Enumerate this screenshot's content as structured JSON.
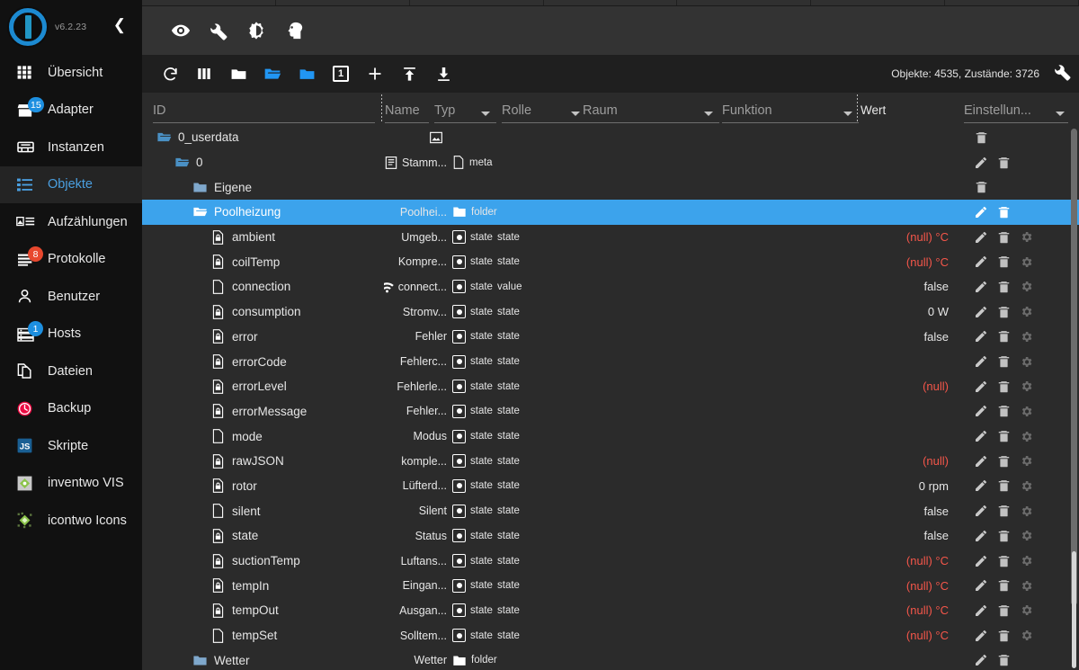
{
  "sidebar": {
    "version": "v6.2.23",
    "collapse_icon": "chevron-left-icon",
    "items": [
      {
        "label": "Übersicht",
        "icon": "grid-icon",
        "badge": null,
        "badge_color": null,
        "active": false
      },
      {
        "label": "Adapter",
        "icon": "shop-icon",
        "badge": "15",
        "badge_color": "#1d8fe0",
        "active": false
      },
      {
        "label": "Instanzen",
        "icon": "instances-icon",
        "badge": null,
        "badge_color": null,
        "active": false
      },
      {
        "label": "Objekte",
        "icon": "list-icon",
        "badge": null,
        "badge_color": null,
        "active": true
      },
      {
        "label": "Aufzählungen",
        "icon": "enums-icon",
        "badge": null,
        "badge_color": null,
        "active": false
      },
      {
        "label": "Protokolle",
        "icon": "logs-icon",
        "badge": "8",
        "badge_color": "#e8482e",
        "active": false
      },
      {
        "label": "Benutzer",
        "icon": "user-icon",
        "badge": null,
        "badge_color": null,
        "active": false
      },
      {
        "label": "Hosts",
        "icon": "hosts-icon",
        "badge": "1",
        "badge_color": "#1d8fe0",
        "active": false
      },
      {
        "label": "Dateien",
        "icon": "files-icon",
        "badge": null,
        "badge_color": null,
        "active": false
      },
      {
        "label": "Backup",
        "icon": "backup-clock-icon",
        "badge": null,
        "badge_color": null,
        "active": false
      },
      {
        "label": "Skripte",
        "icon": "javascript-icon",
        "badge": null,
        "badge_color": null,
        "active": false
      },
      {
        "label": "inventwo VIS",
        "icon": "vis-icon",
        "badge": null,
        "badge_color": null,
        "active": false
      },
      {
        "label": "icontwo Icons",
        "icon": "icons-icon",
        "badge": null,
        "badge_color": null,
        "active": false
      }
    ]
  },
  "app_toolbar": {
    "icons": [
      "eye-icon",
      "wrench-icon",
      "brightness-icon",
      "expert-head-icon"
    ]
  },
  "objects_toolbar": {
    "icons": [
      "refresh-icon",
      "columns-icon",
      "folder-closed-icon",
      "folder-open-icon",
      "folder-filled-icon",
      "depth-1-icon",
      "plus-icon",
      "upload-icon",
      "download-icon"
    ],
    "depth_label": "1",
    "counts": "Objekte: 4535, Zustände: 3726",
    "settings_icon": "wrench-icon"
  },
  "columns": {
    "id": "ID",
    "name": "Name",
    "typ": "Typ",
    "rolle": "Rolle",
    "raum": "Raum",
    "funktion": "Funktion",
    "wert": "Wert",
    "einstellungen": "Einstellun..."
  },
  "colors": {
    "accent": "#3ca3ec",
    "null_value": "#f4564a",
    "sidebar_bg": "#111111",
    "main_bg": "#2b2b2b",
    "toolbar_bg": "#333333",
    "objtoolbar_bg": "#1f1f1f"
  },
  "rows": [
    {
      "id": "0_userdata",
      "indent": 0,
      "kind": "folder-open",
      "name": "",
      "name_icon": "image-icon",
      "typ": "",
      "typ_icon": "",
      "rolle": "",
      "value": "",
      "null": false,
      "actions": [
        "delete"
      ]
    },
    {
      "id": "0",
      "indent": 1,
      "kind": "folder-open",
      "name": "Stamm...",
      "name_icon": "doc-lines-icon",
      "typ": "meta",
      "typ_icon": "file-icon",
      "rolle": "",
      "value": "",
      "null": false,
      "actions": [
        "edit",
        "delete"
      ]
    },
    {
      "id": "Eigene",
      "indent": 2,
      "kind": "folder-filled",
      "name": "",
      "name_icon": "",
      "typ": "",
      "typ_icon": "",
      "rolle": "",
      "value": "",
      "null": false,
      "actions": [
        "delete"
      ]
    },
    {
      "id": "Poolheizung",
      "indent": 2,
      "kind": "folder-open",
      "name": "Poolhei...",
      "name_icon": "",
      "typ": "folder",
      "typ_icon": "folder-filled-icon",
      "rolle": "",
      "value": "",
      "null": false,
      "actions": [
        "edit",
        "delete"
      ],
      "selected": true
    },
    {
      "id": "ambient",
      "indent": 3,
      "kind": "state-lock",
      "name": "Umgeb...",
      "name_icon": "",
      "typ": "state",
      "typ_icon": "state-box-icon",
      "rolle": "state",
      "value": "(null) °C",
      "null": true,
      "actions": [
        "edit",
        "delete",
        "gear"
      ]
    },
    {
      "id": "coilTemp",
      "indent": 3,
      "kind": "state-lock",
      "name": "Kompre...",
      "name_icon": "",
      "typ": "state",
      "typ_icon": "state-box-icon",
      "rolle": "state",
      "value": "(null) °C",
      "null": true,
      "actions": [
        "edit",
        "delete",
        "gear"
      ]
    },
    {
      "id": "connection",
      "indent": 3,
      "kind": "state-plain",
      "name": "connect...",
      "name_icon": "wifi-icon",
      "typ": "state",
      "typ_icon": "state-box-icon",
      "rolle": "value",
      "value": "false",
      "null": false,
      "actions": [
        "edit",
        "delete",
        "gear"
      ]
    },
    {
      "id": "consumption",
      "indent": 3,
      "kind": "state-lock",
      "name": "Stromv...",
      "name_icon": "",
      "typ": "state",
      "typ_icon": "state-box-icon",
      "rolle": "state",
      "value": "0 W",
      "null": false,
      "actions": [
        "edit",
        "delete",
        "gear"
      ]
    },
    {
      "id": "error",
      "indent": 3,
      "kind": "state-lock",
      "name": "Fehler",
      "name_icon": "",
      "typ": "state",
      "typ_icon": "state-box-icon",
      "rolle": "state",
      "value": "false",
      "null": false,
      "actions": [
        "edit",
        "delete",
        "gear"
      ]
    },
    {
      "id": "errorCode",
      "indent": 3,
      "kind": "state-lock",
      "name": "Fehlerc...",
      "name_icon": "",
      "typ": "state",
      "typ_icon": "state-box-icon",
      "rolle": "state",
      "value": "",
      "null": false,
      "actions": [
        "edit",
        "delete",
        "gear"
      ]
    },
    {
      "id": "errorLevel",
      "indent": 3,
      "kind": "state-lock",
      "name": "Fehlerle...",
      "name_icon": "",
      "typ": "state",
      "typ_icon": "state-box-icon",
      "rolle": "state",
      "value": "(null)",
      "null": true,
      "actions": [
        "edit",
        "delete",
        "gear"
      ]
    },
    {
      "id": "errorMessage",
      "indent": 3,
      "kind": "state-lock",
      "name": "Fehler...",
      "name_icon": "",
      "typ": "state",
      "typ_icon": "state-box-icon",
      "rolle": "state",
      "value": "",
      "null": false,
      "actions": [
        "edit",
        "delete",
        "gear"
      ]
    },
    {
      "id": "mode",
      "indent": 3,
      "kind": "state-plain",
      "name": "Modus",
      "name_icon": "",
      "typ": "state",
      "typ_icon": "state-box-icon",
      "rolle": "state",
      "value": "",
      "null": false,
      "actions": [
        "edit",
        "delete",
        "gear"
      ]
    },
    {
      "id": "rawJSON",
      "indent": 3,
      "kind": "state-lock",
      "name": "komple...",
      "name_icon": "",
      "typ": "state",
      "typ_icon": "state-box-icon",
      "rolle": "state",
      "value": "(null)",
      "null": true,
      "actions": [
        "edit",
        "delete",
        "gear"
      ]
    },
    {
      "id": "rotor",
      "indent": 3,
      "kind": "state-lock",
      "name": "Lüfterd...",
      "name_icon": "",
      "typ": "state",
      "typ_icon": "state-box-icon",
      "rolle": "state",
      "value": "0 rpm",
      "null": false,
      "actions": [
        "edit",
        "delete",
        "gear"
      ]
    },
    {
      "id": "silent",
      "indent": 3,
      "kind": "state-plain",
      "name": "Silent",
      "name_icon": "",
      "typ": "state",
      "typ_icon": "state-box-icon",
      "rolle": "state",
      "value": "false",
      "null": false,
      "actions": [
        "edit",
        "delete",
        "gear"
      ]
    },
    {
      "id": "state",
      "indent": 3,
      "kind": "state-lock",
      "name": "Status",
      "name_icon": "",
      "typ": "state",
      "typ_icon": "state-box-icon",
      "rolle": "state",
      "value": "false",
      "null": false,
      "actions": [
        "edit",
        "delete",
        "gear"
      ]
    },
    {
      "id": "suctionTemp",
      "indent": 3,
      "kind": "state-lock",
      "name": "Luftans...",
      "name_icon": "",
      "typ": "state",
      "typ_icon": "state-box-icon",
      "rolle": "state",
      "value": "(null) °C",
      "null": true,
      "actions": [
        "edit",
        "delete",
        "gear"
      ]
    },
    {
      "id": "tempIn",
      "indent": 3,
      "kind": "state-lock",
      "name": "Eingan...",
      "name_icon": "",
      "typ": "state",
      "typ_icon": "state-box-icon",
      "rolle": "state",
      "value": "(null) °C",
      "null": true,
      "actions": [
        "edit",
        "delete",
        "gear"
      ]
    },
    {
      "id": "tempOut",
      "indent": 3,
      "kind": "state-lock",
      "name": "Ausgan...",
      "name_icon": "",
      "typ": "state",
      "typ_icon": "state-box-icon",
      "rolle": "state",
      "value": "(null) °C",
      "null": true,
      "actions": [
        "edit",
        "delete",
        "gear"
      ]
    },
    {
      "id": "tempSet",
      "indent": 3,
      "kind": "state-plain",
      "name": "Solltem...",
      "name_icon": "",
      "typ": "state",
      "typ_icon": "state-box-icon",
      "rolle": "state",
      "value": "(null) °C",
      "null": true,
      "actions": [
        "edit",
        "delete",
        "gear"
      ]
    },
    {
      "id": "Wetter",
      "indent": 2,
      "kind": "folder-filled",
      "name": "Wetter",
      "name_icon": "",
      "typ": "folder",
      "typ_icon": "folder-white-icon",
      "rolle": "",
      "value": "",
      "null": false,
      "actions": [
        "edit",
        "delete"
      ]
    }
  ]
}
